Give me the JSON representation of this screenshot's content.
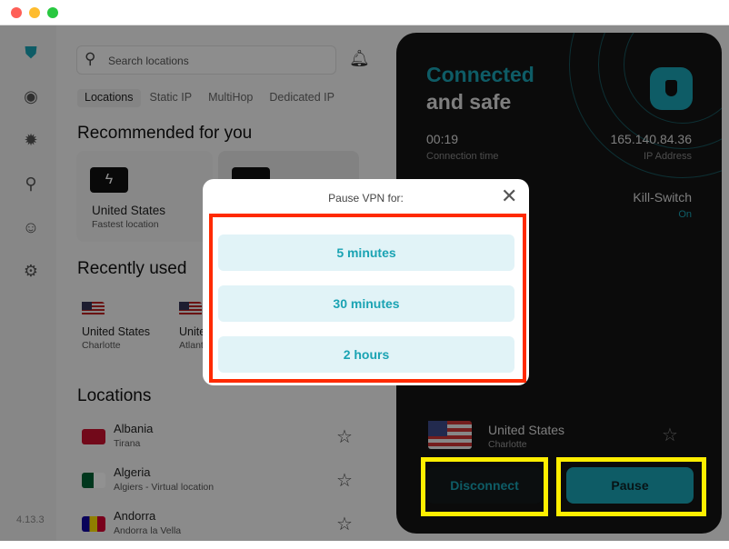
{
  "window": {
    "controls": [
      "close",
      "minimize",
      "zoom"
    ]
  },
  "sidebar": {
    "icons": [
      "shield-icon",
      "alert-icon",
      "bug-icon",
      "search-zoom-icon",
      "account-icon",
      "gear-icon"
    ],
    "version": "4.13.3"
  },
  "search": {
    "placeholder": "Search locations"
  },
  "tabs": [
    "Locations",
    "Static IP",
    "MultiHop",
    "Dedicated IP"
  ],
  "recommended": {
    "heading": "Recommended for you",
    "card": {
      "name": "United States",
      "sub": "Fastest location"
    }
  },
  "recent": {
    "heading": "Recently used",
    "items": [
      {
        "name": "United States",
        "sub": "Charlotte"
      },
      {
        "name": "United States",
        "sub": "Atlanta"
      }
    ]
  },
  "locations": {
    "heading": "Locations",
    "items": [
      {
        "name": "Albania",
        "sub": "Tirana"
      },
      {
        "name": "Algeria",
        "sub": "Algiers - Virtual location"
      },
      {
        "name": "Andorra",
        "sub": "Andorra la Vella"
      }
    ]
  },
  "status": {
    "line1": "Connected",
    "line2": "and safe",
    "time": "00:19",
    "time_label": "Connection time",
    "ip": "165.140.84.36",
    "ip_label": "IP Address",
    "kill_switch": "Kill-Switch",
    "kill_switch_state": "On",
    "current_name": "United States",
    "current_sub": "Charlotte",
    "disconnect": "Disconnect",
    "pause": "Pause"
  },
  "modal": {
    "title": "Pause VPN for:",
    "options": [
      "5 minutes",
      "30 minutes",
      "2 hours"
    ]
  },
  "colors": {
    "accent": "#1aa3b3",
    "highlight_red": "#ff2a00",
    "highlight_yellow": "#ffee00"
  }
}
